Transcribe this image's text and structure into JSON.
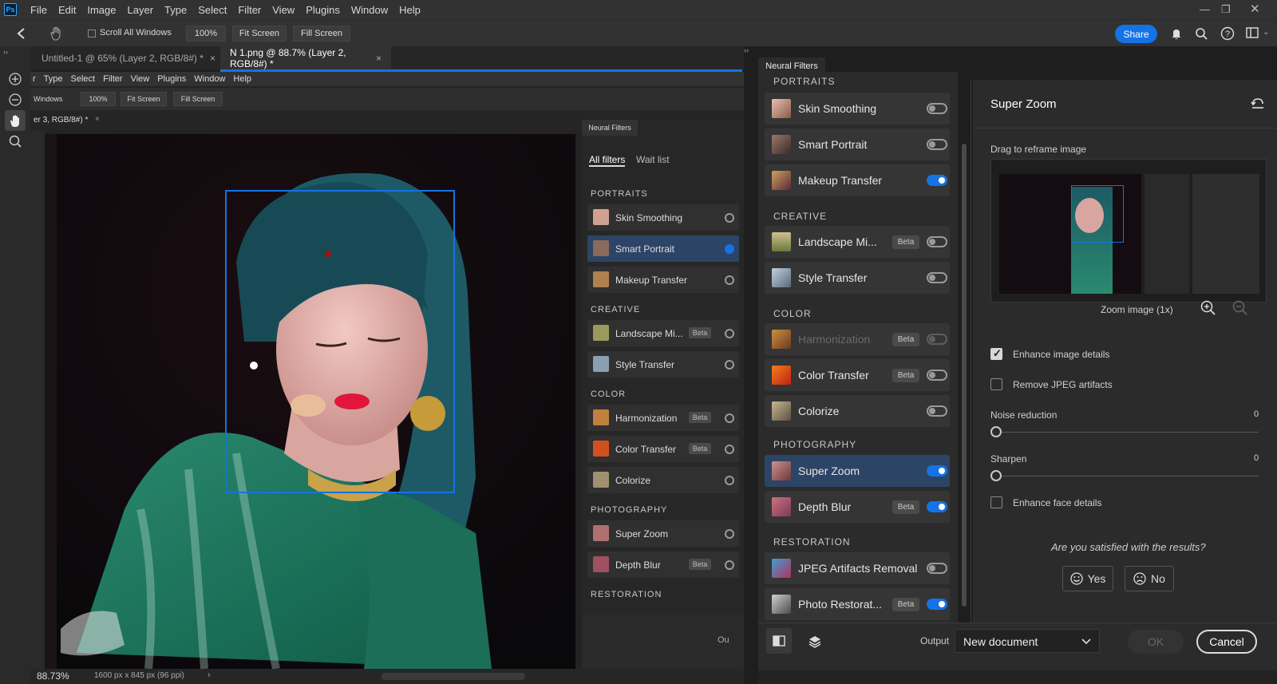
{
  "app": {
    "logo": "Ps"
  },
  "menubar": {
    "items": [
      "File",
      "Edit",
      "Image",
      "Layer",
      "Type",
      "Select",
      "Filter",
      "View",
      "Plugins",
      "Window",
      "Help"
    ]
  },
  "options": {
    "scroll_all_windows": "Scroll All Windows",
    "zoom": "100%",
    "fit_screen": "Fit Screen",
    "fill_screen": "Fill Screen",
    "share": "Share"
  },
  "tabs": [
    {
      "label": "Untitled-1 @ 65% (Layer 2, RGB/8#) *",
      "active": false
    },
    {
      "label": "N 1.png @ 88.7% (Layer 2, RGB/8#) *",
      "active": true
    }
  ],
  "status": {
    "zoom": "88.73%",
    "doc_info": "1600 px x 845 px (96 ppi)"
  },
  "inner": {
    "menu": [
      "r",
      "Type",
      "Select",
      "Filter",
      "View",
      "Plugins",
      "Window",
      "Help"
    ],
    "windows": "Windows",
    "zoom": "100%",
    "fit_screen": "Fit Screen",
    "fill_screen": "Fill Screen",
    "tab": "er 3, RGB/8#) *",
    "nf_title": "Neural Filters",
    "all_filters": "All filters",
    "wait_list": "Wait list",
    "sections": {
      "portraits": "PORTRAITS",
      "creative": "CREATIVE",
      "color": "COLOR",
      "photography": "PHOTOGRAPHY",
      "restoration": "RESTORATION"
    },
    "rows": {
      "skin": "Skin Smoothing",
      "smart": "Smart Portrait",
      "makeup": "Makeup Transfer",
      "landscape": "Landscape Mi...",
      "style": "Style Transfer",
      "harmonization": "Harmonization",
      "color_transfer": "Color Transfer",
      "colorize": "Colorize",
      "super_zoom": "Super Zoom",
      "depth_blur": "Depth Blur"
    },
    "beta": "Beta",
    "output_partial": "Ou"
  },
  "neural_filters": {
    "title": "Neural Filters",
    "sections": {
      "portraits": "PORTRAITS",
      "creative": "CREATIVE",
      "color": "COLOR",
      "photography": "PHOTOGRAPHY",
      "restoration": "RESTORATION"
    },
    "beta_label": "Beta",
    "filters": {
      "skin": {
        "label": "Skin Smoothing",
        "on": false
      },
      "smart": {
        "label": "Smart Portrait",
        "on": false
      },
      "makeup": {
        "label": "Makeup Transfer",
        "on": true
      },
      "landscape": {
        "label": "Landscape Mi...",
        "on": false
      },
      "style": {
        "label": "Style Transfer",
        "on": false
      },
      "harmonization": {
        "label": "Harmonization",
        "on": false
      },
      "color_transfer": {
        "label": "Color Transfer",
        "on": false
      },
      "colorize": {
        "label": "Colorize",
        "on": false
      },
      "super_zoom": {
        "label": "Super Zoom",
        "on": true
      },
      "depth_blur": {
        "label": "Depth Blur",
        "on": true
      },
      "jpeg": {
        "label": "JPEG Artifacts Removal",
        "on": false
      },
      "photo_restoration": {
        "label": "Photo Restorat...",
        "on": true
      }
    }
  },
  "super_zoom": {
    "title": "Super Zoom",
    "drag_label": "Drag to reframe image",
    "zoom_label": "Zoom image (1x)",
    "enhance_details": {
      "label": "Enhance image details",
      "checked": true
    },
    "remove_jpeg": {
      "label": "Remove JPEG artifacts",
      "checked": false
    },
    "noise_reduction": {
      "label": "Noise reduction",
      "value": "0"
    },
    "sharpen": {
      "label": "Sharpen",
      "value": "0"
    },
    "enhance_face": {
      "label": "Enhance face details",
      "checked": false
    },
    "satisfied": "Are you satisfied with the results?",
    "yes": "Yes",
    "no": "No"
  },
  "bottom": {
    "output_label": "Output",
    "output_value": "New document",
    "ok": "OK",
    "cancel": "Cancel"
  },
  "colors": {
    "accent": "#1473e6",
    "panel": "#2b2b2b",
    "selected_row": "#2c4566"
  }
}
